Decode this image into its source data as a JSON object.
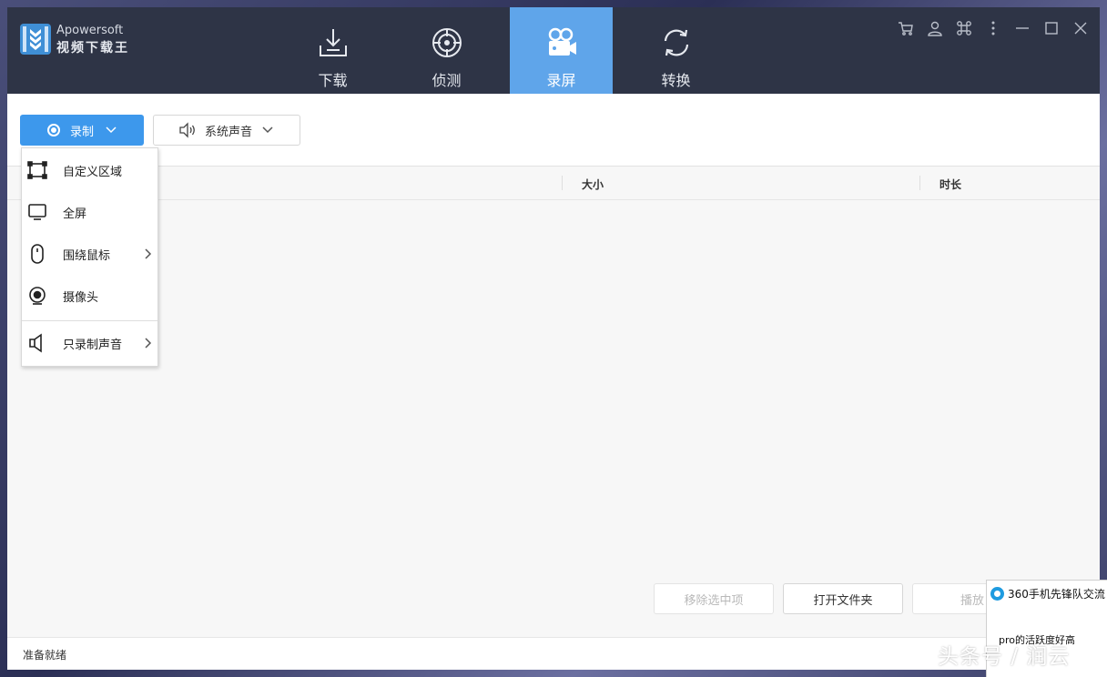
{
  "app": {
    "brand_en": "Apowersoft",
    "brand_cn": "视频下载王",
    "accent_color": "#5fa5ea",
    "titlebar_color": "#2e3446"
  },
  "nav": {
    "tabs": [
      {
        "label": "下载",
        "icon": "download-icon",
        "active": false
      },
      {
        "label": "侦测",
        "icon": "detect-icon",
        "active": false
      },
      {
        "label": "录屏",
        "icon": "video-camera-icon",
        "active": true
      },
      {
        "label": "转换",
        "icon": "convert-icon",
        "active": false
      }
    ]
  },
  "window_controls": [
    "cart-icon",
    "user-icon",
    "command-icon",
    "more-icon",
    "minimize-icon",
    "maximize-icon",
    "close-icon"
  ],
  "toolbar": {
    "record_label": "录制",
    "sound_label": "系统声音"
  },
  "record_menu": {
    "items": [
      {
        "label": "自定义区域",
        "icon": "custom-region-icon",
        "submenu": false
      },
      {
        "label": "全屏",
        "icon": "monitor-icon",
        "submenu": false
      },
      {
        "label": "围绕鼠标",
        "icon": "mouse-icon",
        "submenu": true
      },
      {
        "label": "摄像头",
        "icon": "webcam-icon",
        "submenu": false
      },
      {
        "label": "只录制声音",
        "icon": "speaker-icon",
        "submenu": true
      }
    ]
  },
  "table": {
    "columns": [
      "大小",
      "时长"
    ]
  },
  "actions": {
    "remove_selected": "移除选中项",
    "open_folder": "打开文件夹",
    "play": "播放"
  },
  "status": {
    "text": "准备就绪"
  },
  "popup": {
    "title": "360手机先锋队交流",
    "message": "pro的活跃度好高"
  },
  "watermark": "头条号 / 润云"
}
